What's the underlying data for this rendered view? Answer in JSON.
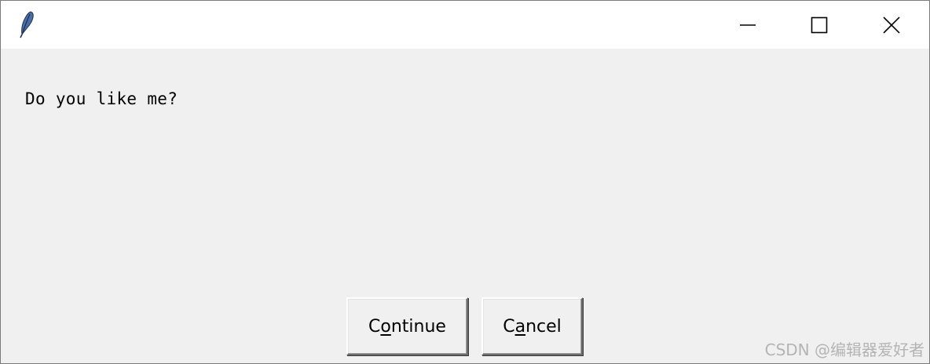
{
  "window": {
    "icon": "feather-icon",
    "controls": {
      "minimize_icon": "minimize-icon",
      "maximize_icon": "maximize-icon",
      "close_icon": "close-icon"
    }
  },
  "dialog": {
    "message": "Do you like me?",
    "buttons": {
      "continue": {
        "pre": "C",
        "underlined": "o",
        "post": "ntinue"
      },
      "cancel": {
        "pre": "C",
        "underlined": "a",
        "post": "ncel"
      }
    }
  },
  "watermark": "CSDN @编辑器爱好者",
  "colors": {
    "titlebar_bg": "#ffffff",
    "client_bg": "#f0f0f0",
    "text": "#000000",
    "watermark": "#b4b4b4"
  }
}
